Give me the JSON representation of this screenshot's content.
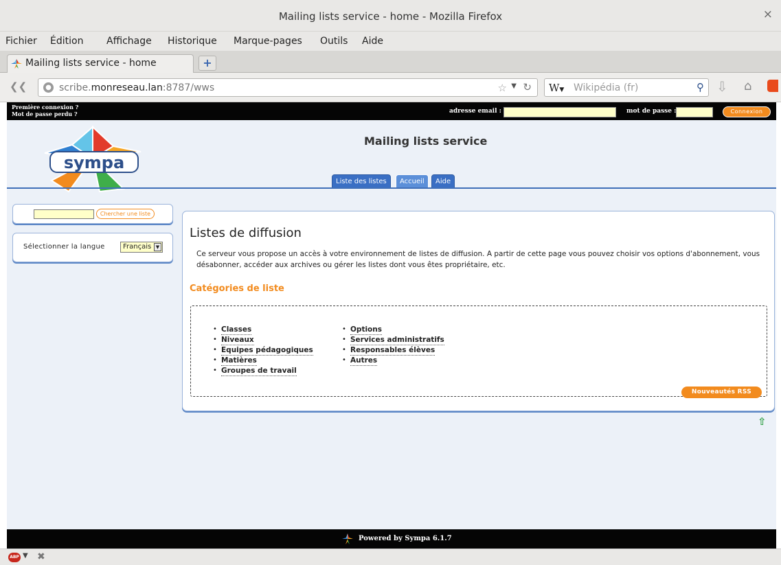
{
  "window": {
    "title": "Mailing lists service - home - Mozilla Firefox",
    "close_glyph": "×"
  },
  "menu": [
    "Fichier",
    "Édition",
    "Affichage",
    "Historique",
    "Marque-pages",
    "Outils",
    "Aide"
  ],
  "browser_tab": {
    "label": "Mailing lists service - home",
    "new_tab_glyph": "+"
  },
  "url": {
    "prefix": "scribe.",
    "host": "monreseau.lan",
    "suffix": ":8787/wws"
  },
  "search": {
    "engine": "W",
    "placeholder": "Wikipédia (fr)"
  },
  "page": {
    "login": {
      "first_login": "Première connexion ?",
      "lost_password": "Mot de passe perdu ?",
      "email_label": "adresse email :",
      "password_label": "mot de passe :",
      "connect_button": "Connexion"
    },
    "logo_text": "sympa",
    "service_title": "Mailing lists service",
    "tabs": [
      {
        "label": "Liste des listes",
        "active": false
      },
      {
        "label": "Accueil",
        "active": true
      },
      {
        "label": "Aide",
        "active": false
      }
    ],
    "sidebar": {
      "search_button": "Chercher une liste",
      "language_label": "Sélectionner la langue",
      "language_value": "Français"
    },
    "main": {
      "heading": "Listes de diffusion",
      "intro": "Ce serveur vous propose un accès à votre environnement de listes de diffusion. A partir de cette page vous pouvez choisir vos options d'abonnement, vous désabonner, accéder aux archives ou gérer les listes dont vous êtes propriétaire, etc.",
      "categories_heading": "Catégories de liste",
      "categories_left": [
        "Classes",
        "Niveaux",
        "Equipes pédagogiques",
        "Matières",
        "Groupes de travail"
      ],
      "categories_right": [
        "Options",
        "Services administratifs",
        "Responsables élèves",
        "Autres"
      ],
      "rss_button": "Nouveautés RSS"
    },
    "footer": "Powered by Sympa 6.1.7"
  },
  "statusbar": {
    "abp": "ABP"
  },
  "colors": {
    "accent_orange": "#f28b1e",
    "nav_blue": "#3a6fc4",
    "page_bg": "#ecf1f8"
  }
}
